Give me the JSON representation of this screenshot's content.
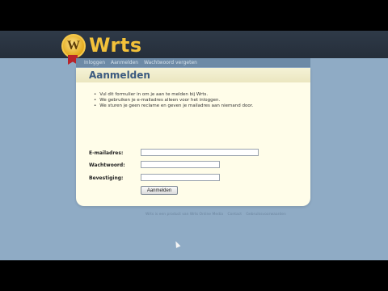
{
  "brand": {
    "name": "Wrts",
    "badge_letter": "W"
  },
  "nav": {
    "items": [
      {
        "label": "Inloggen"
      },
      {
        "label": "Aanmelden"
      },
      {
        "label": "Wachtwoord vergeten"
      }
    ]
  },
  "panel": {
    "title": "Aanmelden",
    "bullets": [
      "Vul dit formulier in om je aan te melden bij Wrts.",
      "We gebruiken je e-mailadres alleen voor het inloggen.",
      "We sturen je geen reclame en geven je mailadres aan niemand door."
    ]
  },
  "form": {
    "email_label": "E-mailadres:",
    "email_value": "",
    "password_label": "Wachtwoord:",
    "password_value": "",
    "confirm_label": "Bevestiging:",
    "confirm_value": "",
    "submit_label": "Aanmelden"
  },
  "footer": {
    "items": [
      {
        "label": "Wrts is een product van Wrts Online Media"
      },
      {
        "label": "Contact"
      },
      {
        "label": "Gebruiksvoorwaarden"
      }
    ]
  },
  "colors": {
    "background": "#8fabc5",
    "topbar": "#2f3a48",
    "panel": "#fffde9",
    "title_text": "#3b5a7f",
    "logo_yellow": "#f3c23a"
  }
}
